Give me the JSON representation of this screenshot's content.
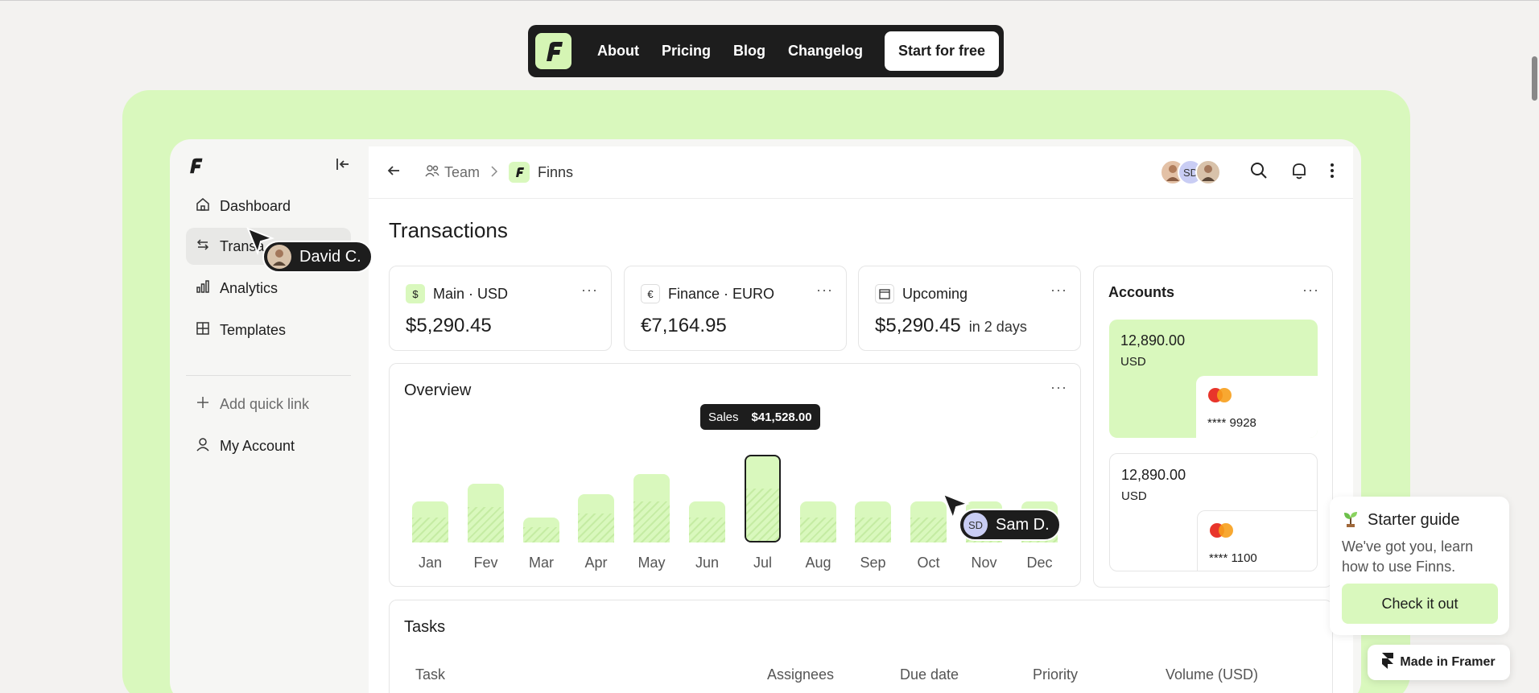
{
  "topnav": {
    "links": [
      "About",
      "Pricing",
      "Blog",
      "Changelog"
    ],
    "cta": "Start for free"
  },
  "sidebar": {
    "items": [
      {
        "label": "Dashboard",
        "icon": "home-icon"
      },
      {
        "label": "Transa",
        "icon": "arrows-swap-icon"
      },
      {
        "label": "Analytics",
        "icon": "bar-chart-icon"
      },
      {
        "label": "Templates",
        "icon": "grid-icon"
      }
    ],
    "quick_link": "Add quick link",
    "account": "My Account"
  },
  "header": {
    "team": "Team",
    "workspace": "Finns",
    "avatar_initials": "SD"
  },
  "page": {
    "title": "Transactions"
  },
  "balances": [
    {
      "icon": "$",
      "label": "Main · USD",
      "value": "$5,290.45",
      "suffix": ""
    },
    {
      "icon": "€",
      "label": "Finance · EURO",
      "value": "€7,164.95",
      "suffix": ""
    },
    {
      "icon": "calendar-icon",
      "label": "Upcoming",
      "value": "$5,290.45",
      "suffix": "in 2 days"
    }
  ],
  "accounts": {
    "title": "Accounts",
    "cards": [
      {
        "amount": "12,890.00",
        "currency": "USD",
        "card": "**** 9928"
      },
      {
        "amount": "12,890.00",
        "currency": "USD",
        "card": "**** 1100"
      }
    ]
  },
  "overview": {
    "title": "Overview",
    "tooltip": {
      "label": "Sales",
      "value": "$41,528.00"
    }
  },
  "chart_data": {
    "type": "bar",
    "categories": [
      "Jan",
      "Fev",
      "Mar",
      "Apr",
      "May",
      "Jun",
      "Jul",
      "Aug",
      "Sep",
      "Oct",
      "Nov",
      "Dec"
    ],
    "values": [
      0.39,
      0.56,
      0.24,
      0.46,
      0.65,
      0.39,
      0.84,
      0.39,
      0.39,
      0.39,
      0.39,
      0.39
    ],
    "highlighted": "Jul",
    "title": "Overview",
    "colors": {
      "bar": "#d9f8bd",
      "hatch": "#c5eca3",
      "highlight_border": "#1d1d1d"
    }
  },
  "cursors": [
    {
      "name": "David C."
    },
    {
      "name": "Sam D.",
      "initials": "SD"
    }
  ],
  "tasks": {
    "title": "Tasks",
    "columns": [
      "Task",
      "Assignees",
      "Due date",
      "Priority",
      "Volume (USD)"
    ]
  },
  "starter": {
    "title": "Starter guide",
    "body": "We've got you, learn how to use Finns.",
    "button": "Check it out"
  },
  "framer_badge": "Made in Framer",
  "colors": {
    "accent": "#d9f8bd",
    "dark": "#1d1d1d"
  }
}
